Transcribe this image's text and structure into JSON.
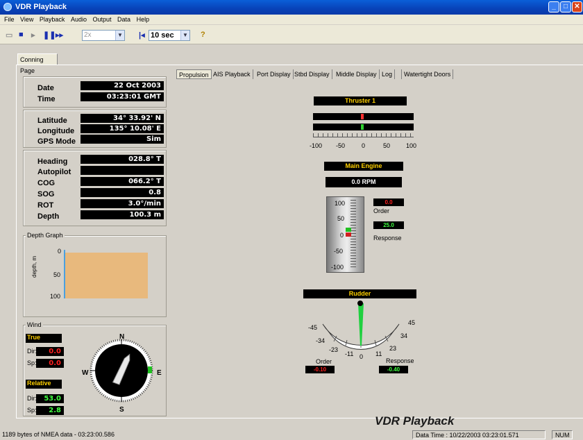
{
  "window": {
    "title": "VDR Playback"
  },
  "menu": [
    "File",
    "View",
    "Playback",
    "Audio",
    "Output",
    "Data",
    "Help"
  ],
  "toolbar": {
    "speed": "2x",
    "skip": "10 sec"
  },
  "tabs": {
    "conning": "Conning Page",
    "right": [
      "Propulsion",
      "AIS Playback",
      "Port Display",
      "Stbd Display",
      "Middle Display",
      "Log",
      "Watertight Doors"
    ]
  },
  "nav": {
    "date_label": "Date",
    "date": "22 Oct 2003",
    "time_label": "Time",
    "time": "03:23:01 GMT",
    "lat_label": "Latitude",
    "lat": "34° 33.92' N",
    "lon_label": "Longitude",
    "lon": "135° 10.08' E",
    "gps_label": "GPS Mode",
    "gps": "Sim",
    "heading_label": "Heading",
    "heading": "028.8° T",
    "autopilot_label": "Autopilot",
    "autopilot": "",
    "cog_label": "COG",
    "cog": "066.2° T",
    "sog_label": "SOG",
    "sog": "0.8",
    "rot_label": "ROT",
    "rot": "3.0°/min",
    "depth_label": "Depth",
    "depth": "100.3 m"
  },
  "depth_graph": {
    "title": "Depth Graph",
    "ylabel": "depth, m",
    "ticks": [
      "0",
      "50",
      "100"
    ]
  },
  "wind": {
    "title": "Wind",
    "true_label": "True",
    "dir_label": "Dir:",
    "sp_label": "Sp:",
    "true_dir": "0.0",
    "true_sp": "0.0",
    "rel_label": "Relative",
    "rel_dir": "53.0",
    "rel_sp": "2.8",
    "compass": [
      "N",
      "E",
      "S",
      "W"
    ]
  },
  "thruster": {
    "title": "Thruster 1",
    "scale": [
      "-100",
      "-50",
      "0",
      "50",
      "100"
    ]
  },
  "engine": {
    "title": "Main Engine",
    "rpm": "0.0 RPM",
    "order": "0.0",
    "order_label": "Order",
    "response": "25.0",
    "response_label": "Response",
    "scale": [
      "100",
      "50",
      "0",
      "-50",
      "-100"
    ]
  },
  "rudder": {
    "title": "Rudder",
    "scale": [
      "-45",
      "-34",
      "-23",
      "-11",
      "0",
      "11",
      "23",
      "34",
      "45"
    ],
    "order_label": "Order",
    "order": "-0.10",
    "response_label": "Response",
    "response": "-0.40"
  },
  "brand": "VDR Playback",
  "status": {
    "left": "1189 bytes of NMEA data - 03:23:00.586",
    "datatime": "Data Time : 10/22/2003 03:23:01.571",
    "num": "NUM"
  },
  "colors": {
    "accent": "#0842b8",
    "alarm": "#cc0000",
    "ok": "#00c000"
  }
}
